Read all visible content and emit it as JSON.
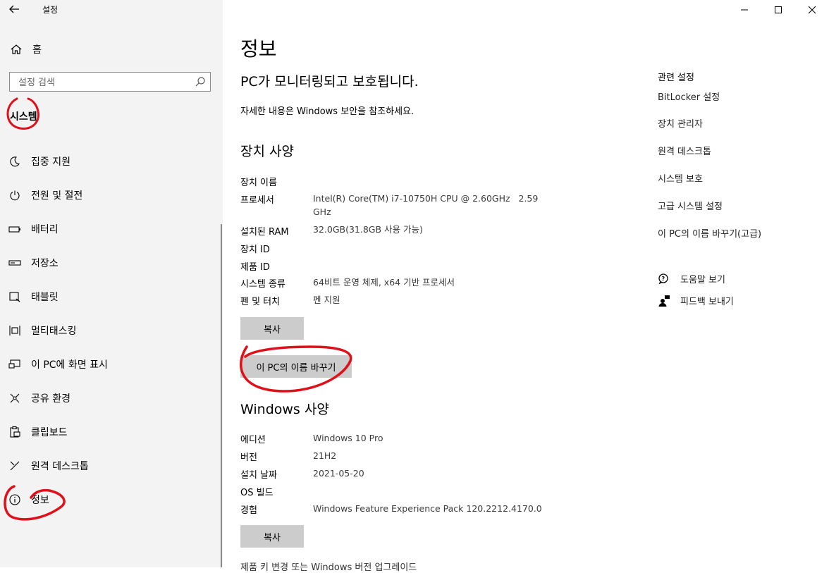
{
  "window": {
    "title": "설정",
    "controls": [
      "minimize-icon",
      "maximize-icon",
      "close-icon"
    ]
  },
  "sidebar": {
    "home_label": "홈",
    "search_placeholder": "설정 검색",
    "section_title": "시스템",
    "items": [
      {
        "label": "집중 지원",
        "icon": "moon-icon"
      },
      {
        "label": "전원 및 절전",
        "icon": "power-icon"
      },
      {
        "label": "배터리",
        "icon": "battery-icon"
      },
      {
        "label": "저장소",
        "icon": "storage-icon"
      },
      {
        "label": "태블릿",
        "icon": "tablet-icon"
      },
      {
        "label": "멀티태스킹",
        "icon": "multitasking-icon"
      },
      {
        "label": "이 PC에 화면 표시",
        "icon": "project-icon"
      },
      {
        "label": "공유 환경",
        "icon": "shared-experiences-icon"
      },
      {
        "label": "클립보드",
        "icon": "clipboard-icon"
      },
      {
        "label": "원격 데스크톱",
        "icon": "remote-desktop-icon"
      },
      {
        "label": "정보",
        "icon": "info-icon"
      }
    ]
  },
  "main": {
    "title": "정보",
    "protection_status": "PC가 모니터링되고 보호됩니다.",
    "security_note": "자세한 내용은 Windows 보안을 참조하세요.",
    "device_specs": {
      "heading": "장치 사양",
      "rows": [
        {
          "label": "장치 이름",
          "value": ""
        },
        {
          "label": "프로세서",
          "value": "Intel(R) Core(TM) i7-10750H CPU @ 2.60GHz   2.59",
          "value2": "GHz"
        },
        {
          "label": "설치된 RAM",
          "value": "32.0GB(31.8GB 사용 가능)"
        },
        {
          "label": "장치 ID",
          "value": ""
        },
        {
          "label": "제품 ID",
          "value": ""
        },
        {
          "label": "시스템 종류",
          "value": "64비트 운영 체제, x64 기반 프로세서"
        },
        {
          "label": "펜 및 터치",
          "value": "펜 지원"
        }
      ],
      "copy_button": "복사",
      "rename_button": "이 PC의 이름 바꾸기"
    },
    "windows_specs": {
      "heading": "Windows 사양",
      "rows": [
        {
          "label": "에디션",
          "value": "Windows 10 Pro"
        },
        {
          "label": "버전",
          "value": "21H2"
        },
        {
          "label": "설치 날짜",
          "value": "2021-05-20"
        },
        {
          "label": "OS 빌드",
          "value": ""
        },
        {
          "label": "경험",
          "value": "Windows Feature Experience Pack 120.2212.4170.0"
        }
      ],
      "copy_button": "복사",
      "cut_off_link": "제품 키 변경 또는 Windows 버전 업그레이드"
    }
  },
  "related": {
    "title": "관련 설정",
    "links": [
      "BitLocker 설정",
      "장치 관리자",
      "원격 데스크톱",
      "시스템 보호",
      "고급 시스템 설정",
      "이 PC의 이름 바꾸기(고급)"
    ],
    "help_label": "도움말 보기",
    "feedback_label": "피드백 보내기"
  },
  "annotation_color": "#e0101a"
}
